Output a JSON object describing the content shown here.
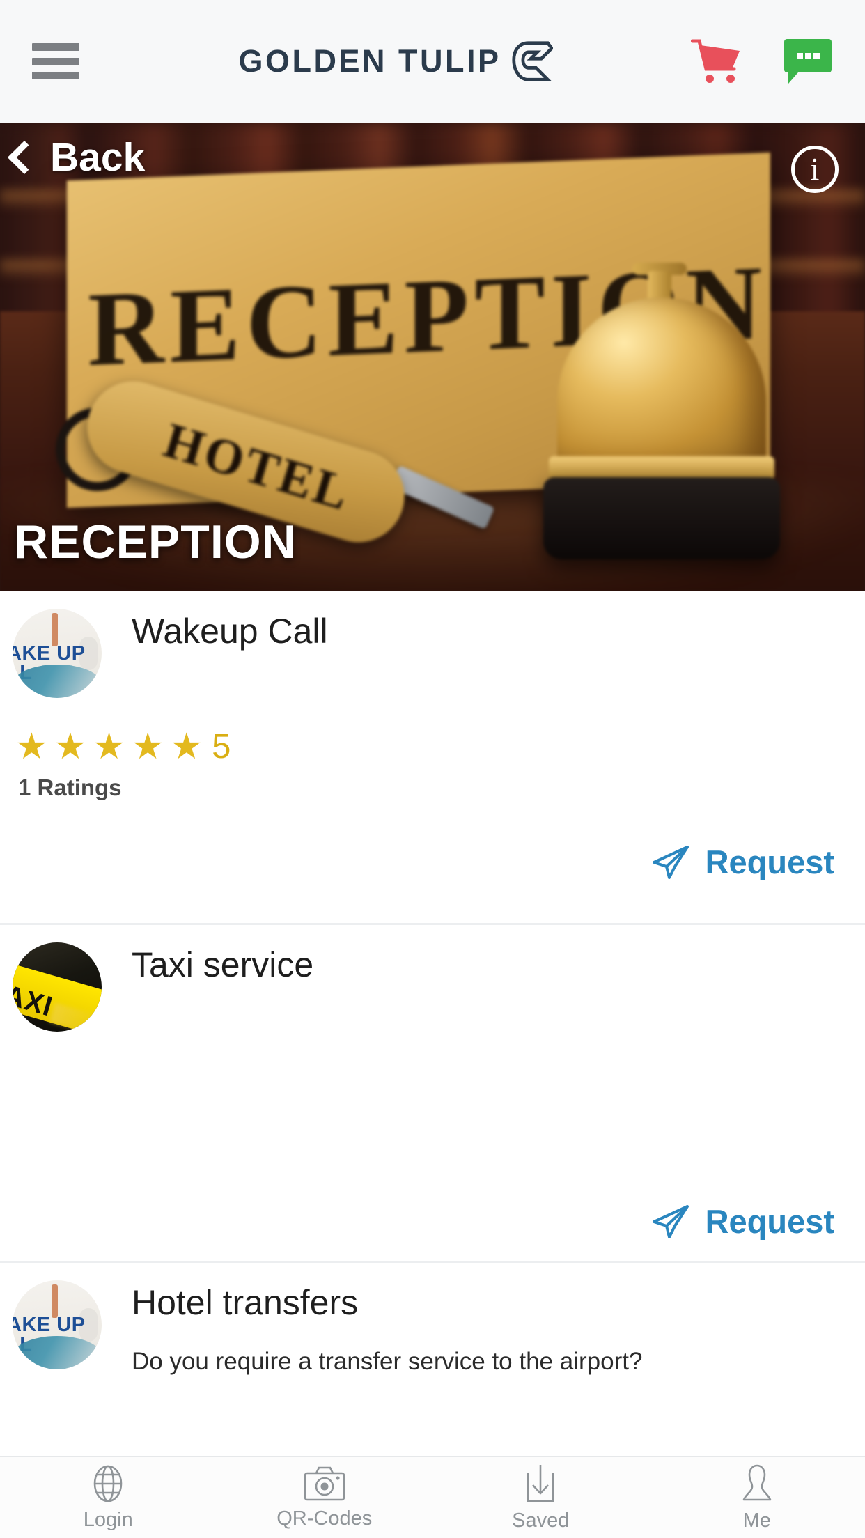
{
  "header": {
    "menu_icon": "hamburger-menu-icon",
    "brand_name": "GOLDEN TULIP",
    "brand_mark": "golden-tulip-g-icon",
    "cart_icon": "shopping-cart-icon",
    "chat_icon": "chat-bubble-icon",
    "cart_color": "#e8505b",
    "chat_color": "#3bb54a",
    "brand_color": "#2b3b4c"
  },
  "hero": {
    "back_label": "Back",
    "back_icon": "chevron-left-icon",
    "info_icon": "info-icon",
    "info_glyph": "i",
    "title": "RECEPTION",
    "image_alt": "hotel reception sign with brass service bell and HOTEL key fob",
    "sign_text": "RECEPTION",
    "fob_text": "HOTEL"
  },
  "services": [
    {
      "title": "Wakeup Call",
      "description": "",
      "thumbnail": "wake-up-call-thumbnail",
      "thumb_line1": "AKE UP",
      "thumb_line2": "LL",
      "rating": {
        "stars": 5,
        "value": "5",
        "star_glyph": "★",
        "count_label": "1 Ratings"
      },
      "action": {
        "label": "Request",
        "icon": "send-paper-plane-icon"
      }
    },
    {
      "title": "Taxi service",
      "description": "",
      "thumbnail": "taxi-service-thumbnail",
      "thumb_text": "AXI",
      "rating": null,
      "action": {
        "label": "Request",
        "icon": "send-paper-plane-icon"
      }
    },
    {
      "title": "Hotel transfers",
      "description": "Do you require a transfer service to the airport?",
      "thumbnail": "wake-up-call-thumbnail",
      "thumb_line1": "AKE UP",
      "thumb_line2": "LL",
      "rating": null,
      "action": null
    }
  ],
  "bottom_nav": [
    {
      "label": "Login",
      "icon": "globe-icon"
    },
    {
      "label": "QR-Codes",
      "icon": "camera-icon"
    },
    {
      "label": "Saved",
      "icon": "save-download-icon"
    },
    {
      "label": "Me",
      "icon": "person-icon"
    }
  ],
  "colors": {
    "accent_blue": "#2a86bf",
    "star_gold": "#e3b91f",
    "nav_gray": "#8f9498"
  }
}
